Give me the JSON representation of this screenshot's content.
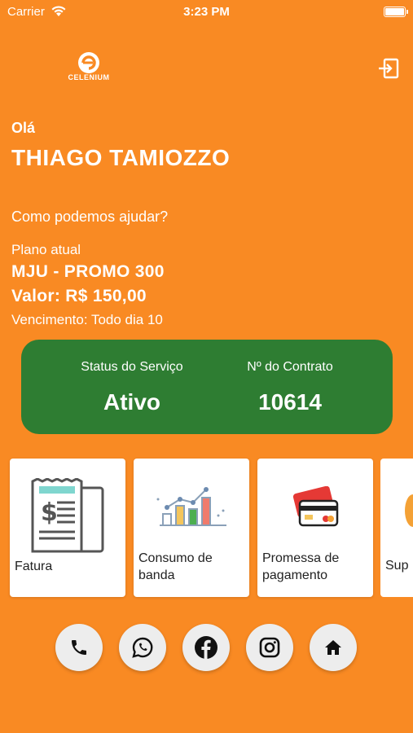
{
  "status_bar": {
    "carrier": "Carrier",
    "time": "3:23 PM"
  },
  "header": {
    "logo_text": "CELENIUM",
    "logout_icon": "logout-icon"
  },
  "greeting": {
    "hello": "Olá",
    "name": "THIAGO TAMIOZZO",
    "help": "Como podemos ajudar?"
  },
  "plan": {
    "label": "Plano atual",
    "name": "MJU - PROMO 300",
    "value": "Valor: R$ 150,00",
    "due": "Vencimento: Todo dia 10"
  },
  "status_card": {
    "service_label": "Status do Serviço",
    "service_value": "Ativo",
    "contract_label": "Nº do Contrato",
    "contract_value": "10614",
    "color": "#2E7D32"
  },
  "cards": [
    {
      "label": "Fatura",
      "icon": "invoice-icon"
    },
    {
      "label": "Consumo de banda",
      "icon": "bandwidth-chart-icon"
    },
    {
      "label": "Promessa de pagamento",
      "icon": "credit-card-icon"
    },
    {
      "label": "Sup",
      "icon": "support-icon"
    }
  ],
  "bottom_actions": [
    {
      "name": "phone",
      "icon": "phone-icon"
    },
    {
      "name": "whatsapp",
      "icon": "whatsapp-icon"
    },
    {
      "name": "facebook",
      "icon": "facebook-icon"
    },
    {
      "name": "instagram",
      "icon": "instagram-icon"
    },
    {
      "name": "home",
      "icon": "home-icon"
    }
  ],
  "colors": {
    "background": "#F98A23",
    "card": "#FFFFFF",
    "status_green": "#2E7D32"
  }
}
